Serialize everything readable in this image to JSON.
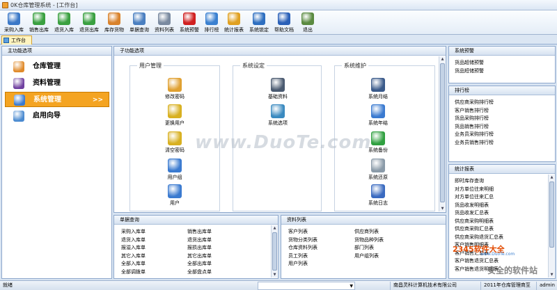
{
  "window": {
    "title": "0K仓库管理系统 - [工作台]"
  },
  "toolbar": [
    {
      "label": "采购入库",
      "icon": "purchase-in-icon",
      "color": "#3b78c7"
    },
    {
      "label": "销售出库",
      "icon": "sales-out-icon",
      "color": "#3aa040"
    },
    {
      "label": "退货入库",
      "icon": "return-in-icon",
      "color": "#3aa040"
    },
    {
      "label": "退货出库",
      "icon": "return-out-icon",
      "color": "#3aa040"
    },
    {
      "label": "库存货物",
      "icon": "inventory-icon",
      "color": "#d9822b"
    },
    {
      "label": "单据查询",
      "icon": "document-query-icon",
      "color": "#4a7fc0"
    },
    {
      "label": "资料列表",
      "icon": "data-list-icon",
      "color": "#7a8aa0"
    },
    {
      "label": "系统预警",
      "icon": "alarm-icon",
      "color": "#d02020"
    },
    {
      "label": "排行榜",
      "icon": "ranking-icon",
      "color": "#3a80d0"
    },
    {
      "label": "统计报表",
      "icon": "pie-chart-icon",
      "color": "#e0a020"
    },
    {
      "label": "系统锁定",
      "icon": "lock-icon",
      "color": "#2e6fc0"
    },
    {
      "label": "帮助文档",
      "icon": "help-icon",
      "color": "#2a60b8"
    },
    {
      "label": "退出",
      "icon": "exit-icon",
      "color": "#5a8a40"
    }
  ],
  "tab": {
    "label": "工作台"
  },
  "nav": {
    "header": "主功能选项",
    "items": [
      {
        "label": "仓库管理",
        "icon": "warehouse-icon",
        "color": "#e08a2a"
      },
      {
        "label": "资料管理",
        "icon": "books-icon",
        "color": "#7040a0"
      },
      {
        "label": "系统管理",
        "icon": "monitor-icon",
        "color": "#3a7ad0",
        "selected": true,
        "arrow": ">>"
      },
      {
        "label": "启用向导",
        "icon": "gear-icon",
        "color": "#4a8ad0"
      }
    ]
  },
  "subfunctions": {
    "header": "子功能选项",
    "groups": [
      {
        "title": "用户管理",
        "items": [
          {
            "label": "修改密码",
            "icon": "edit-password-icon",
            "color": "#e0a030"
          },
          {
            "label": "更换用户",
            "icon": "key-icon",
            "color": "#d8b020"
          },
          {
            "label": "清空密码",
            "icon": "key-clear-icon",
            "color": "#d8b020"
          },
          {
            "label": "用户组",
            "icon": "user-group-icon",
            "color": "#3a7ad0"
          },
          {
            "label": "用户",
            "icon": "user-icon",
            "color": "#3a7ad0"
          }
        ]
      },
      {
        "title": "系统设定",
        "items": [
          {
            "label": "基础资料",
            "icon": "info-icon",
            "color": "#4a5a70"
          },
          {
            "label": "系统选项",
            "icon": "options-icon",
            "color": "#3a8ac0"
          }
        ]
      },
      {
        "title": "系统维护",
        "items": [
          {
            "label": "系统月结",
            "icon": "anchor-icon",
            "color": "#3a5a8a"
          },
          {
            "label": "系统年结",
            "icon": "calendar-icon",
            "color": "#3a7ad0"
          },
          {
            "label": "系统备份",
            "icon": "backup-disc-icon",
            "color": "#30a040"
          },
          {
            "label": "系统还原",
            "icon": "restore-disc-icon",
            "color": "#8a9aa8"
          },
          {
            "label": "系统日志",
            "icon": "log-monitor-icon",
            "color": "#3a6ac0"
          }
        ]
      }
    ]
  },
  "document_query": {
    "header": "单据查询",
    "col1": [
      "采购入库单",
      "退货入库单",
      "报溢入库单",
      "其它入库单",
      "全部入库单",
      "全部调拨单"
    ],
    "col2": [
      "销售出库单",
      "退货出库单",
      "报损出库单",
      "其它出库单",
      "全部出库单",
      "全部盘点单"
    ]
  },
  "data_list": {
    "header": "资料列表",
    "col1": [
      "客户列表",
      "货物分类列表",
      "仓库资料列表",
      "员工列表",
      "用户列表"
    ],
    "col2": [
      "供应商列表",
      "货物品种列表",
      "部门列表",
      "用户组列表"
    ]
  },
  "warnings": {
    "header": "系统预警",
    "items": [
      "货品超储预警",
      "货品短储预警"
    ]
  },
  "rankings": {
    "header": "排行榜",
    "items": [
      "供应商采购排行榜",
      "客户销售排行榜",
      "货品采购排行榜",
      "货品销售排行榜",
      "业务员采购排行榜",
      "业务员销售排行榜"
    ]
  },
  "reports": {
    "header": "统计报表",
    "items": [
      "即时库存查询",
      "对方单位往来明细",
      "对方单位往来汇总",
      "货品收发明细表",
      "货品收发汇总表",
      "供应商采购明细表",
      "供应商采购汇总表",
      "供应商采购退货汇总表",
      "客户销售明细表",
      "客户销售汇总表",
      "客户销售退货汇总表",
      "客户销售退货明细表"
    ]
  },
  "status": {
    "ready": "就绪",
    "company": "南昌灵科计算机技术有限公司",
    "copyright": "2011年仓库管理商至",
    "user": "admin"
  },
  "watermark": {
    "text": "www.DuoTe.com"
  },
  "logo_watermark": {
    "brand": "2345软件大全",
    "site": "www.DuoTe.com",
    "slogan": "安全的软件站"
  }
}
